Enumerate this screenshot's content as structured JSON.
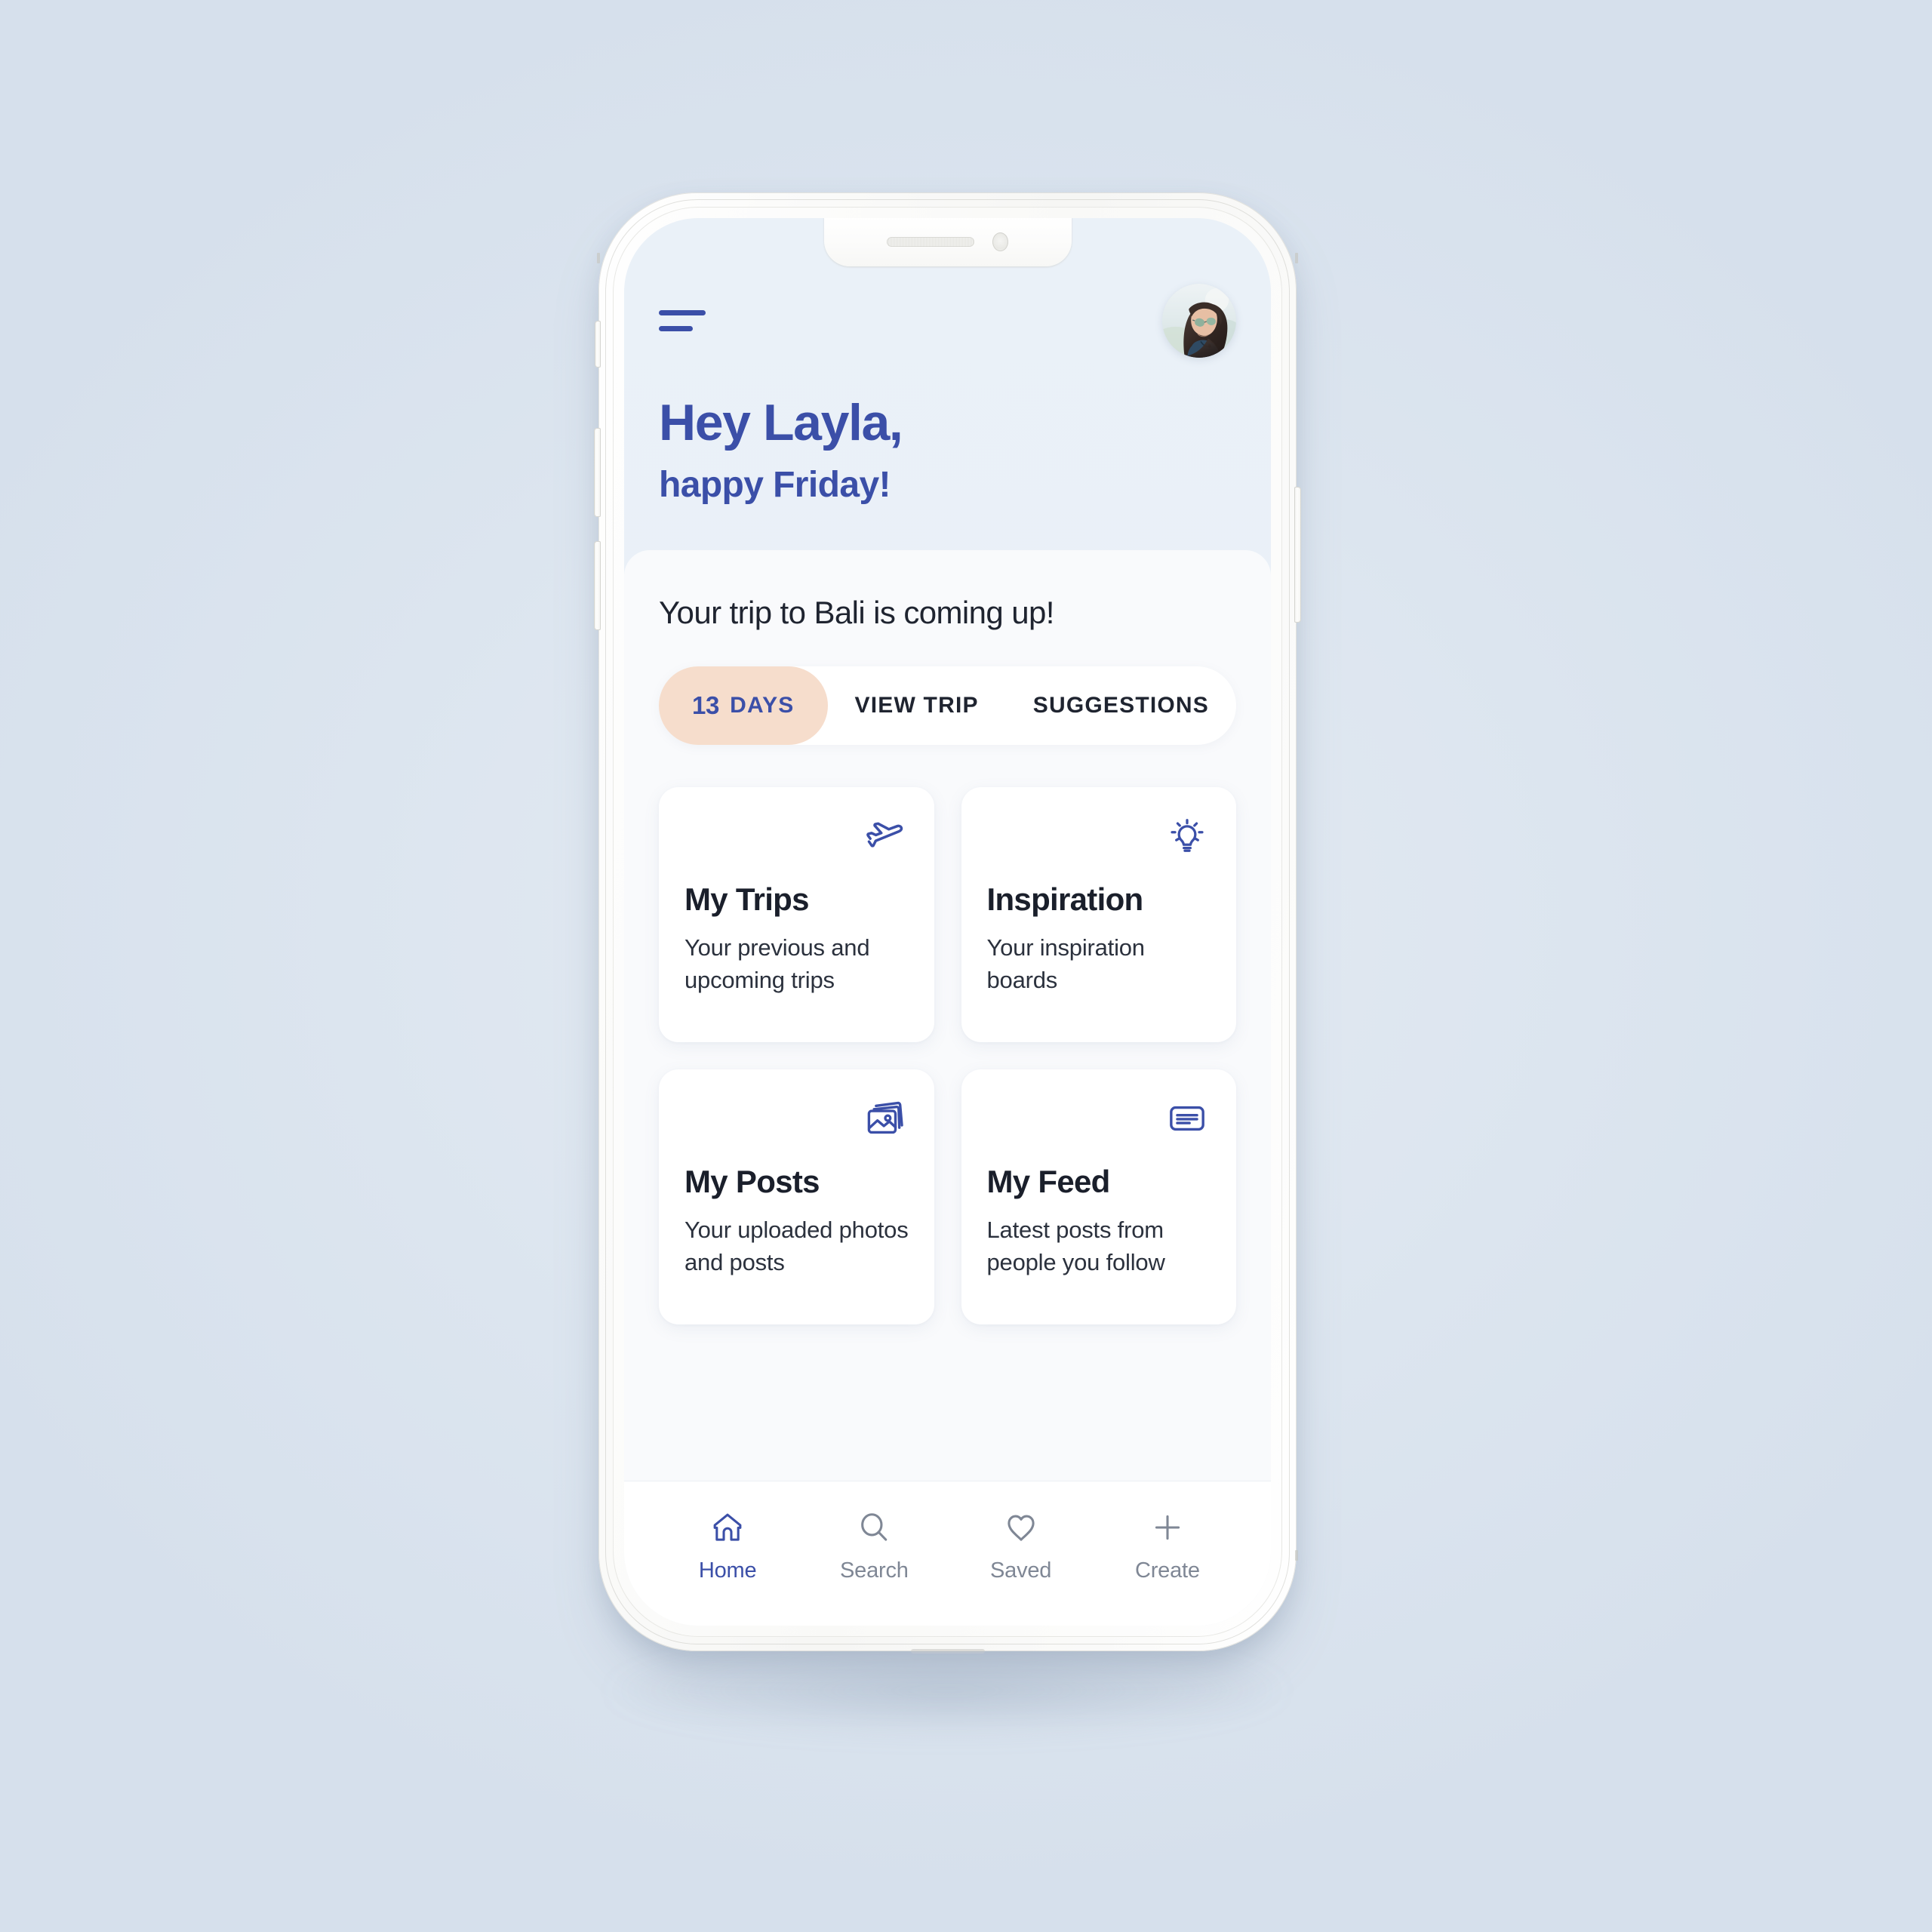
{
  "colors": {
    "brand_blue": "#3b4fa8",
    "page_bg": "#dee6ef",
    "screen_bg": "#eaf0f7",
    "sheet_bg": "#f9fafc",
    "days_pill": "#f6ddcc",
    "card_bg": "#ffffff",
    "text_dark": "#1a1f2b",
    "text_muted": "#7f8795"
  },
  "header": {
    "menu_icon": "hamburger-menu-icon",
    "avatar_icon": "user-avatar-photo",
    "greeting_name": "Hey Layla,",
    "greeting_day": "happy Friday!"
  },
  "trip": {
    "headline": "Your trip to Bali is coming up!",
    "tabs": [
      {
        "id": "days",
        "count": "13",
        "unit": "DAYS",
        "active": true
      },
      {
        "id": "view-trip",
        "label": "VIEW TRIP",
        "active": false
      },
      {
        "id": "suggestions",
        "label": "SUGGESTIONS",
        "active": false
      }
    ]
  },
  "cards": [
    {
      "id": "my-trips",
      "icon": "airplane-icon",
      "title": "My Trips",
      "desc": "Your previous and upcoming trips"
    },
    {
      "id": "inspiration",
      "icon": "lightbulb-icon",
      "title": "Inspiration",
      "desc": "Your inspiration boards"
    },
    {
      "id": "my-posts",
      "icon": "photo-stack-icon",
      "title": "My Posts",
      "desc": "Your uploaded photos and posts"
    },
    {
      "id": "my-feed",
      "icon": "article-lines-icon",
      "title": "My Feed",
      "desc": "Latest posts from people you follow"
    }
  ],
  "bottom_nav": [
    {
      "id": "home",
      "icon": "home-icon",
      "label": "Home",
      "active": true
    },
    {
      "id": "search",
      "icon": "search-icon",
      "label": "Search",
      "active": false
    },
    {
      "id": "saved",
      "icon": "heart-icon",
      "label": "Saved",
      "active": false
    },
    {
      "id": "create",
      "icon": "plus-icon",
      "label": "Create",
      "active": false
    }
  ]
}
